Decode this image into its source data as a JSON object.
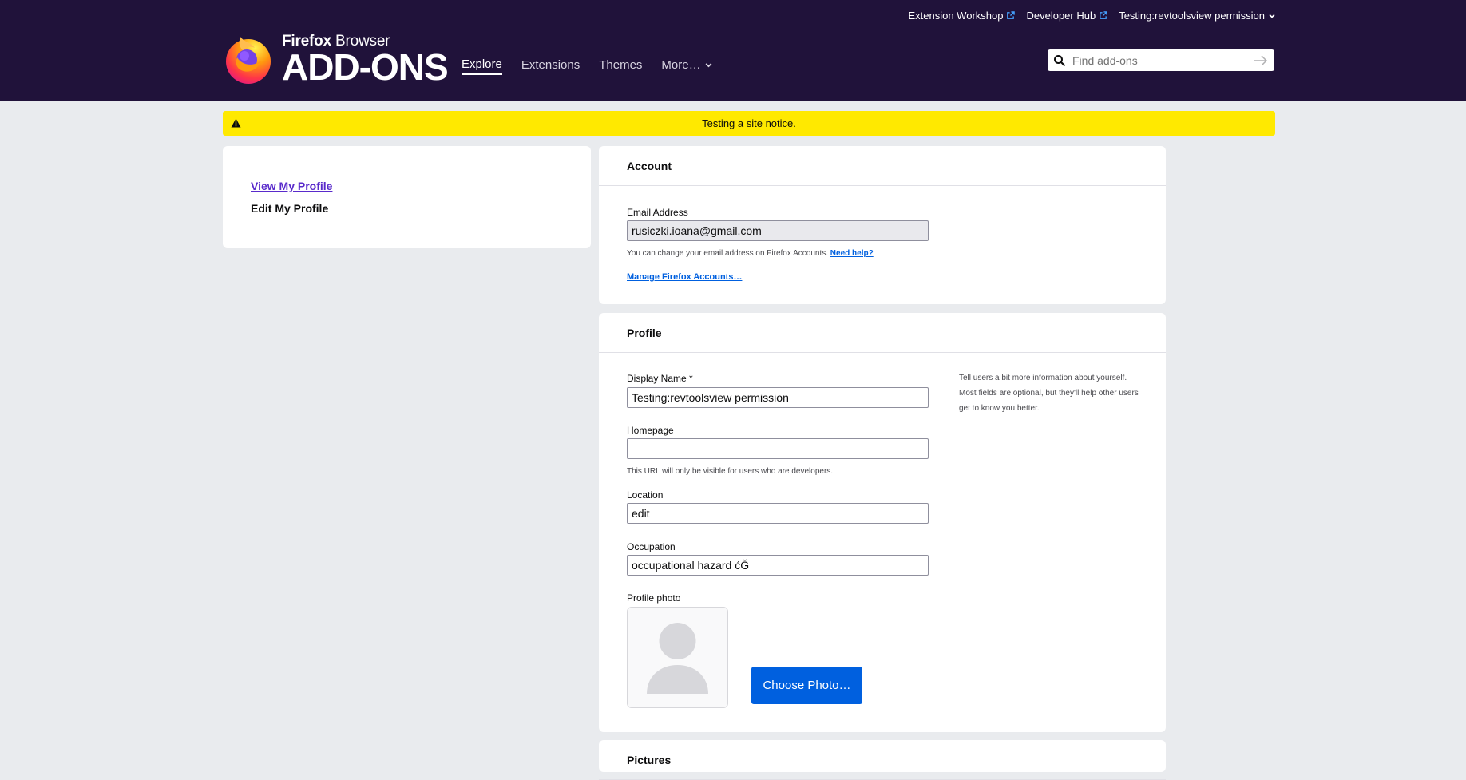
{
  "header": {
    "top_links": {
      "extension_workshop": "Extension Workshop",
      "developer_hub": "Developer Hub",
      "user_name": "Testing:revtoolsview permission"
    },
    "logo_small_bold": "Firefox",
    "logo_small_rest": " Browser",
    "logo_big": "ADD-ONS",
    "nav": {
      "explore": "Explore",
      "extensions": "Extensions",
      "themes": "Themes",
      "more": "More…"
    },
    "search_placeholder": "Find add-ons"
  },
  "notice": "Testing a site notice.",
  "sidebar": {
    "view_profile": "View My Profile",
    "edit_profile": "Edit My Profile"
  },
  "account": {
    "title": "Account",
    "email_label": "Email Address",
    "email_value": "rusiczki.ioana@gmail.com",
    "email_help": "You can change your email address on Firefox Accounts.",
    "need_help": "Need help?",
    "manage_link": "Manage Firefox Accounts…"
  },
  "profile": {
    "title": "Profile",
    "aside": "Tell users a bit more information about yourself. Most fields are optional, but they'll help other users get to know you better.",
    "display_name_label": "Display Name *",
    "display_name_value": "Testing:revtoolsview permission",
    "homepage_label": "Homepage",
    "homepage_value": "",
    "homepage_help": "This URL will only be visible for users who are developers.",
    "location_label": "Location",
    "location_value": "edit",
    "occupation_label": "Occupation",
    "occupation_value": "occupational hazard ćĞ",
    "photo_label": "Profile photo",
    "choose_photo": "Choose Photo…"
  },
  "pictures_title": "Pictures",
  "colors": {
    "header_bg": "#20123a",
    "page_bg": "#e9ebee",
    "notice_bg": "#ffe900",
    "primary_button": "#0060df",
    "visited_link": "#592acb"
  }
}
